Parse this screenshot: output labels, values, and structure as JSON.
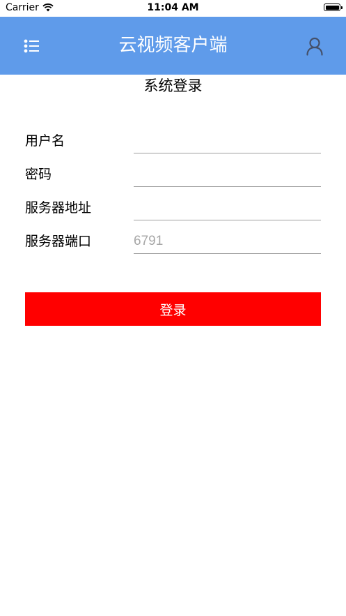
{
  "status_bar": {
    "carrier": "Carrier",
    "time": "11:04 AM"
  },
  "nav": {
    "title": "云视频客户端",
    "bg_color": "#5f9bea"
  },
  "form": {
    "title": "系统登录",
    "fields": [
      {
        "label": "用户名",
        "value": "",
        "placeholder": ""
      },
      {
        "label": "密码",
        "value": "",
        "placeholder": ""
      },
      {
        "label": "服务器地址",
        "value": "",
        "placeholder": ""
      },
      {
        "label": "服务器端口",
        "value": "",
        "placeholder": "6791"
      }
    ],
    "login_label": "登录",
    "login_color": "#ff0000"
  }
}
